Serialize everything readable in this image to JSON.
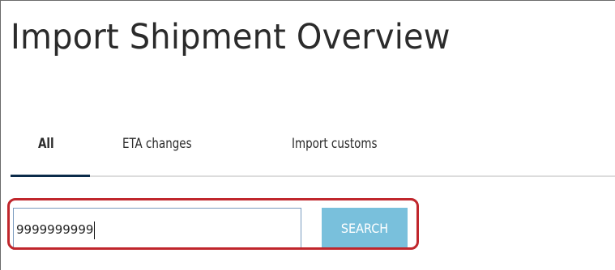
{
  "page": {
    "title": "Import Shipment Overview"
  },
  "tabs": [
    {
      "label": "All",
      "active": true
    },
    {
      "label": "ETA changes",
      "active": false
    },
    {
      "label": "Import customs",
      "active": false
    }
  ],
  "search": {
    "value": "9999999999",
    "button_label": "SEARCH"
  },
  "colors": {
    "tab_indicator": "#0b2b4a",
    "search_button": "#79c0dc",
    "highlight": "#c0262c"
  }
}
